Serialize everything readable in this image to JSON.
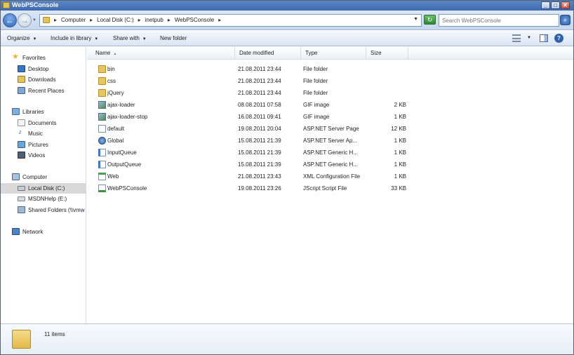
{
  "window": {
    "title": "WebPSConsole"
  },
  "titlebar_buttons": {
    "minimize": "_",
    "maximize": "□",
    "close": "✕"
  },
  "address": {
    "crumbs": [
      "Computer",
      "Local Disk (C:)",
      "inetpub",
      "WebPSConsole"
    ],
    "separator": "▸"
  },
  "search": {
    "placeholder": "Search WebPSConsole"
  },
  "toolbar": {
    "organize": "Organize",
    "include_in_library": "Include in library",
    "share_with": "Share with",
    "new_folder": "New folder",
    "help": "?"
  },
  "sidebar": {
    "favorites": "Favorites",
    "desktop": "Desktop",
    "downloads": "Downloads",
    "recent_places": "Recent Places",
    "libraries": "Libraries",
    "documents": "Documents",
    "music": "Music",
    "pictures": "Pictures",
    "videos": "Videos",
    "computer": "Computer",
    "local_disk": "Local Disk (C:)",
    "msdnhelp": "MSDNHelp (E:)",
    "shared_folders": "Shared Folders (\\\\vmw",
    "network": "Network"
  },
  "columns": {
    "name": "Name",
    "date_modified": "Date modified",
    "type": "Type",
    "size": "Size"
  },
  "files": [
    {
      "name": "bin",
      "date": "21.08.2011 23:44",
      "type": "File folder",
      "size": "",
      "icon": "folder"
    },
    {
      "name": "css",
      "date": "21.08.2011 23:44",
      "type": "File folder",
      "size": "",
      "icon": "folder"
    },
    {
      "name": "jQuery",
      "date": "21.08.2011 23:44",
      "type": "File folder",
      "size": "",
      "icon": "folder"
    },
    {
      "name": "ajax-loader",
      "date": "08.08.2011 07:58",
      "type": "GIF image",
      "size": "2 KB",
      "icon": "gif"
    },
    {
      "name": "ajax-loader-stop",
      "date": "16.08.2011 09:41",
      "type": "GIF image",
      "size": "1 KB",
      "icon": "gif"
    },
    {
      "name": "default",
      "date": "19.08.2011 20:04",
      "type": "ASP.NET Server Page",
      "size": "12 KB",
      "icon": "aspx"
    },
    {
      "name": "Global",
      "date": "15.08.2011 21:39",
      "type": "ASP.NET Server Ap...",
      "size": "1 KB",
      "icon": "asax"
    },
    {
      "name": "InputQueue",
      "date": "15.08.2011 21:39",
      "type": "ASP.NET Generic H...",
      "size": "1 KB",
      "icon": "ashx"
    },
    {
      "name": "OutputQueue",
      "date": "15.08.2011 21:39",
      "type": "ASP.NET Generic H...",
      "size": "1 KB",
      "icon": "ashx"
    },
    {
      "name": "Web",
      "date": "21.08.2011 23:43",
      "type": "XML Configuration File",
      "size": "1 KB",
      "icon": "config"
    },
    {
      "name": "WebPSConsole",
      "date": "19.08.2011 23:26",
      "type": "JScript Script File",
      "size": "33 KB",
      "icon": "js"
    }
  ],
  "status": {
    "items_count": "11 items"
  }
}
